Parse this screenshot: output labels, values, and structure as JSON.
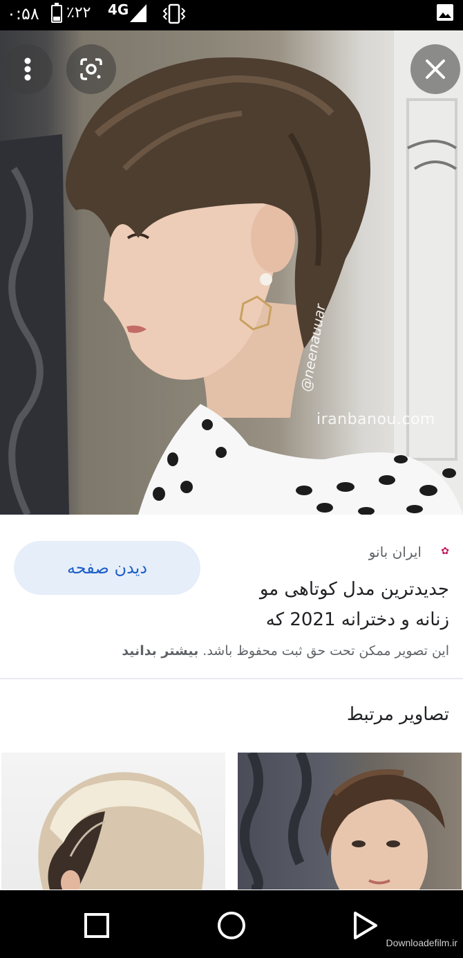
{
  "status_bar": {
    "time": "۰:۵۸",
    "battery_percent": "٪۲۲",
    "network": "4G"
  },
  "hero": {
    "watermark": "iranbanou.com",
    "handle": "@neenauuar",
    "icons": [
      "more-vert-icon",
      "google-lens-icon",
      "close-icon"
    ]
  },
  "result": {
    "view_page_label": "دیدن صفحه",
    "source_name": "ایران بانو",
    "title": "جدیدترین مدل کوتاهی مو زنانه و دخترانه 2021 که",
    "copyright_text": "این تصویر ممکن تحت حق ثبت محفوظ باشد.",
    "learn_more_label": "بیشتر بدانید"
  },
  "related": {
    "title": "تصاویر مرتبط"
  },
  "nav": {
    "icons": [
      "recents-square-icon",
      "home-circle-icon",
      "back-triangle-icon"
    ]
  },
  "footer": {
    "site_mark": "Downloadefilm.ir"
  },
  "colors": {
    "accent": "#1d5fc7",
    "button_bg": "#e6eefa",
    "text_primary": "#202124",
    "text_secondary": "#5f6368"
  }
}
